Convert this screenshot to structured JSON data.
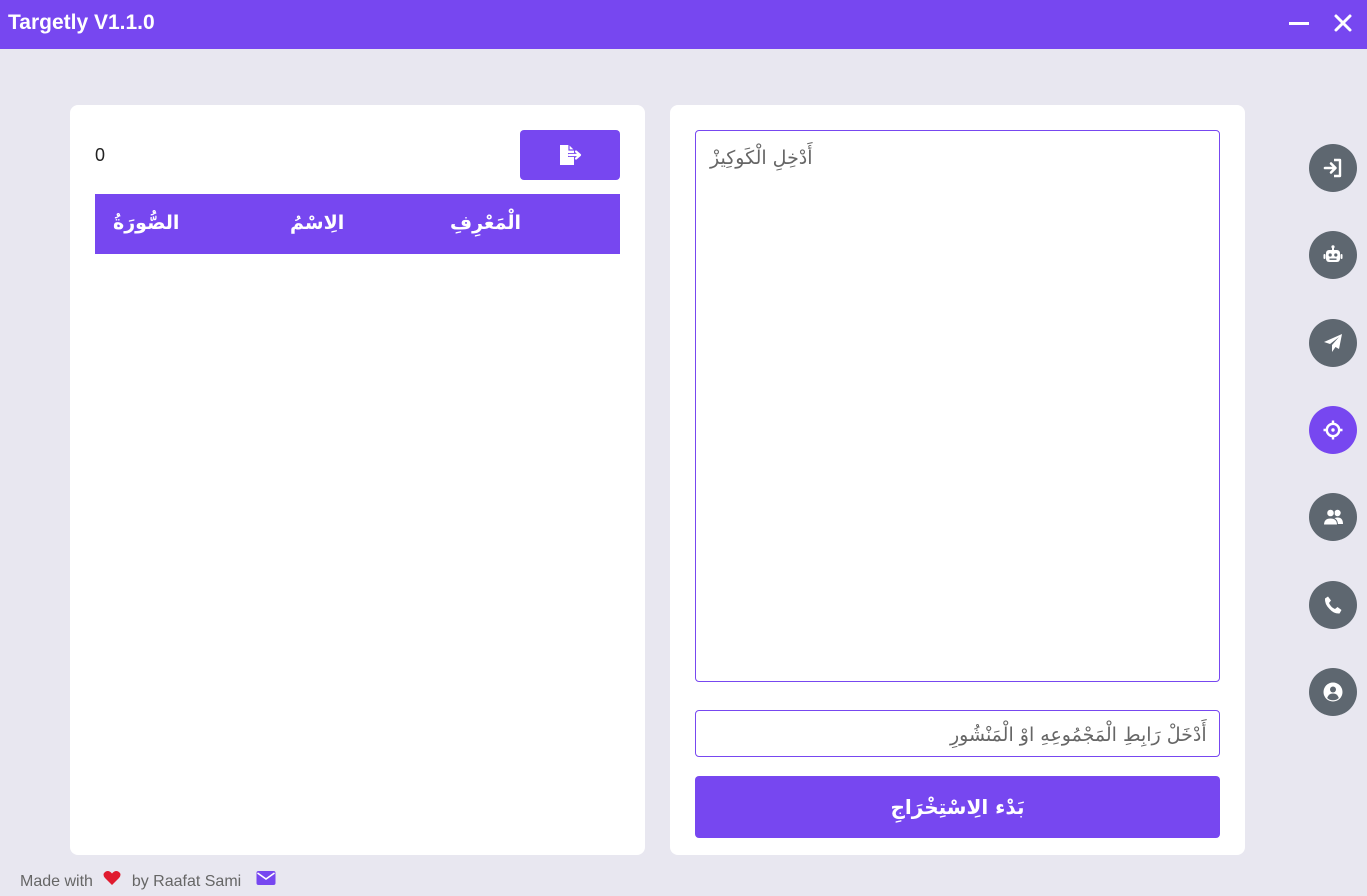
{
  "window": {
    "title": "Targetly V1.1.0",
    "icons": {
      "minimize": "minimize-icon",
      "close": "close-icon"
    }
  },
  "results": {
    "count": "0",
    "export_icon": "file-export-icon",
    "headers": {
      "picture": "الصُّورَةُ",
      "name": "الِاسْمُ",
      "id": "الْمَعْرِفِ"
    },
    "rows": []
  },
  "form": {
    "cookie_placeholder": "أَدْخِلِ الْكَوكِيزْ",
    "link_placeholder": "أَدْخَلْ رَابِطِ الْمَجْمُوعِهِ اوْ الْمَنْشُورِ",
    "start_label": "بَدْء الِاسْتِخْرَاجِ"
  },
  "sidebar": {
    "items": [
      {
        "name": "login",
        "icon": "sign-in-icon",
        "active": false
      },
      {
        "name": "bot",
        "icon": "robot-icon",
        "active": false
      },
      {
        "name": "send",
        "icon": "paper-plane-icon",
        "active": false
      },
      {
        "name": "target",
        "icon": "crosshairs-icon",
        "active": true
      },
      {
        "name": "users",
        "icon": "users-icon",
        "active": false
      },
      {
        "name": "phone",
        "icon": "phone-icon",
        "active": false
      },
      {
        "name": "profile",
        "icon": "user-circle-icon",
        "active": false
      }
    ]
  },
  "footer": {
    "made_with": "Made with",
    "by": "by Raafat Sami",
    "heart_icon": "heart-icon",
    "mail_icon": "envelope-icon"
  },
  "colors": {
    "accent": "#7747f0",
    "side_button": "#5e6770",
    "background": "#e8e7f0"
  }
}
